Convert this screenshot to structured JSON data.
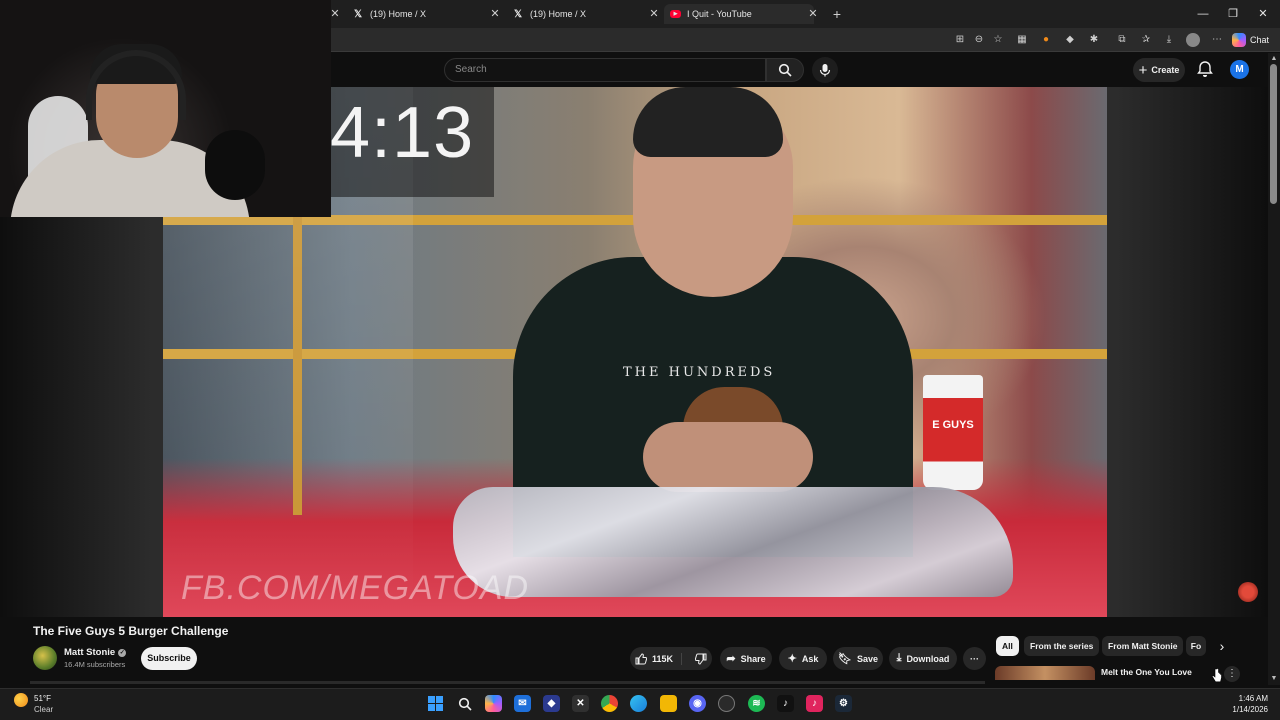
{
  "browser": {
    "tabs": [
      {
        "label": "(19) Home / X",
        "icon": "x-logo-icon"
      },
      {
        "label": "(19) Home / X",
        "icon": "x-logo-icon"
      },
      {
        "label": "I Quit - YouTube",
        "icon": "youtube-logo-icon"
      }
    ],
    "new_tab": "+",
    "chat_label": "Chat",
    "window_controls": {
      "minimize": "—",
      "restore": "❐",
      "close": "✕"
    }
  },
  "youtube": {
    "search_placeholder": "Search",
    "create_label": "Create",
    "avatar_letter": "M"
  },
  "video_overlay": {
    "timer": "4:13",
    "watermark": "FB.COM/MEGATOAD",
    "shirt_text": "THE HUNDREDS",
    "cup_text": "E GUYS"
  },
  "video": {
    "title": "The Five Guys 5 Burger Challenge",
    "channel": "Matt Stonie",
    "subscribers": "16.4M subscribers",
    "subscribe_label": "Subscribe",
    "likes": "115K",
    "share_label": "Share",
    "ask_label": "Ask",
    "save_label": "Save",
    "download_label": "Download",
    "more_label": "···"
  },
  "sidebar": {
    "chips": [
      "All",
      "From the series",
      "From Matt Stonie",
      "Fo"
    ],
    "next_chip": "›",
    "recommendation_title": "Melt the One You Love with LINDOR this Valentine's Day",
    "rec_menu": "⋮"
  },
  "taskbar": {
    "weather_temp": "51°F",
    "weather_condition": "Clear",
    "time": "1:46 AM",
    "date": "1/14/2026"
  },
  "colors": {
    "youtube_red": "#ff0033",
    "accent_blue": "#1a73e8",
    "background": "#0f0f0f"
  }
}
